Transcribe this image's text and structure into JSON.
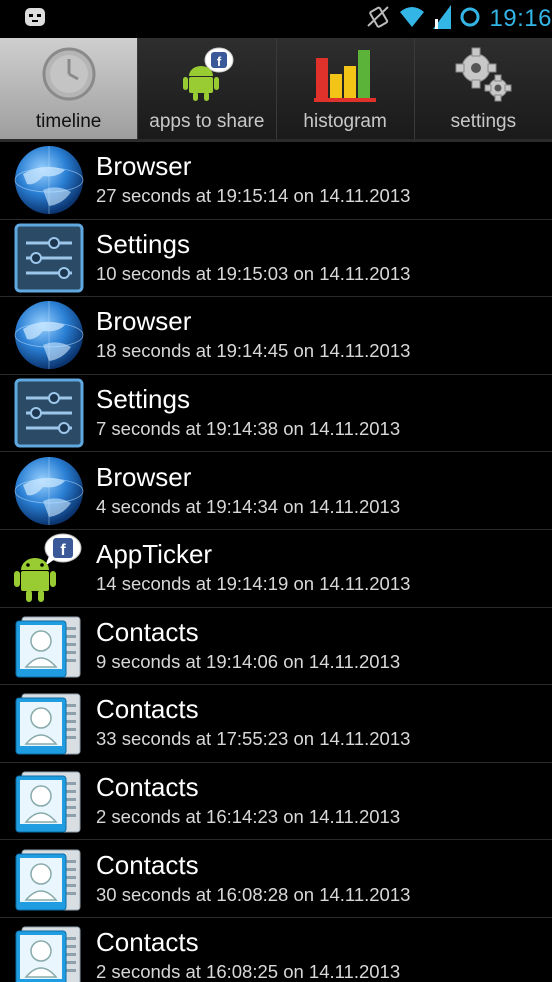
{
  "status_bar": {
    "time": "19:16"
  },
  "tabs": [
    {
      "label": "timeline",
      "icon": "clock-icon",
      "active": true
    },
    {
      "label": "apps to share",
      "icon": "android-share-icon",
      "active": false
    },
    {
      "label": "histogram",
      "icon": "histogram-icon",
      "active": false
    },
    {
      "label": "settings",
      "icon": "gears-icon",
      "active": false
    }
  ],
  "entries": [
    {
      "app": "Browser",
      "detail": "27 seconds at 19:15:14 on 14.11.2013",
      "icon": "globe-icon"
    },
    {
      "app": "Settings",
      "detail": "10 seconds at 19:15:03 on 14.11.2013",
      "icon": "sliders-icon"
    },
    {
      "app": "Browser",
      "detail": "18 seconds at 19:14:45 on 14.11.2013",
      "icon": "globe-icon"
    },
    {
      "app": "Settings",
      "detail": "7 seconds at 19:14:38 on 14.11.2013",
      "icon": "sliders-icon"
    },
    {
      "app": "Browser",
      "detail": "4 seconds at 19:14:34 on 14.11.2013",
      "icon": "globe-icon"
    },
    {
      "app": "AppTicker",
      "detail": "14 seconds at 19:14:19 on 14.11.2013",
      "icon": "android-share-icon"
    },
    {
      "app": "Contacts",
      "detail": "9 seconds at 19:14:06 on 14.11.2013",
      "icon": "contacts-icon"
    },
    {
      "app": "Contacts",
      "detail": "33 seconds at 17:55:23 on 14.11.2013",
      "icon": "contacts-icon"
    },
    {
      "app": "Contacts",
      "detail": "2 seconds at 16:14:23 on 14.11.2013",
      "icon": "contacts-icon"
    },
    {
      "app": "Contacts",
      "detail": "30 seconds at 16:08:28 on 14.11.2013",
      "icon": "contacts-icon"
    },
    {
      "app": "Contacts",
      "detail": "2 seconds at 16:08:25 on 14.11.2013",
      "icon": "contacts-icon"
    }
  ],
  "colors": {
    "accent": "#33b5e5",
    "active_tab": "#b8b8b8"
  }
}
